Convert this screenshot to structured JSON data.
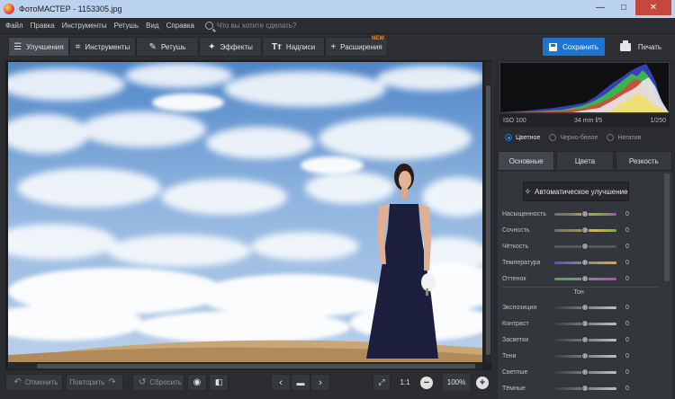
{
  "window": {
    "title": "ФотоМАСТЕР - 1153305.jpg",
    "minimize": "—",
    "maximize": "□",
    "close": "✕"
  },
  "menu": {
    "items": [
      "Файл",
      "Правка",
      "Инструменты",
      "Ретушь",
      "Вид",
      "Справка"
    ],
    "search_placeholder": "Что вы хотите сделать?"
  },
  "toolbar": {
    "tabs": [
      {
        "label": "Улучшения",
        "icon": "sliders-icon"
      },
      {
        "label": "Инструменты",
        "icon": "crop-icon"
      },
      {
        "label": "Ретушь",
        "icon": "brush-icon"
      },
      {
        "label": "Эффекты",
        "icon": "magic-wand-icon"
      },
      {
        "label": "Надписи",
        "icon": "text-icon"
      },
      {
        "label": "Расширения",
        "icon": "plus-icon",
        "badge": "NEW"
      }
    ],
    "save_label": "Сохранить",
    "print_label": "Печать"
  },
  "bottom": {
    "undo_label": "Отменить",
    "redo_label": "Повторить",
    "reset_label": "Сбросить",
    "ratio_label": "1:1",
    "zoom_label": "100%"
  },
  "panel": {
    "exif": {
      "iso": "ISO 100",
      "lens": "34 mm f/5",
      "shutter": "1/250"
    },
    "modes": [
      {
        "label": "Цветное",
        "selected": true
      },
      {
        "label": "Черно-белое",
        "selected": false
      },
      {
        "label": "Негатив",
        "selected": false
      }
    ],
    "subtabs": [
      "Основные",
      "Цвета",
      "Резкость"
    ],
    "auto_label": "Автоматическое улучшение",
    "sliders_color": [
      {
        "label": "Насыщенность",
        "value": "0"
      },
      {
        "label": "Сочность",
        "value": "0"
      },
      {
        "label": "Чёткость",
        "value": "0"
      },
      {
        "label": "Температура",
        "value": "0"
      },
      {
        "label": "Оттенок",
        "value": "0"
      }
    ],
    "section_tone": "Тон",
    "sliders_tone": [
      {
        "label": "Экспозиция",
        "value": "0"
      },
      {
        "label": "Контраст",
        "value": "0"
      },
      {
        "label": "Засветки",
        "value": "0"
      },
      {
        "label": "Тени",
        "value": "0"
      },
      {
        "label": "Светлые",
        "value": "0"
      },
      {
        "label": "Тёмные",
        "value": "0"
      }
    ]
  },
  "colors": {
    "accent": "#1c75d0",
    "badge": "#ff8a1c",
    "titlebar": "#bcd3ef"
  }
}
